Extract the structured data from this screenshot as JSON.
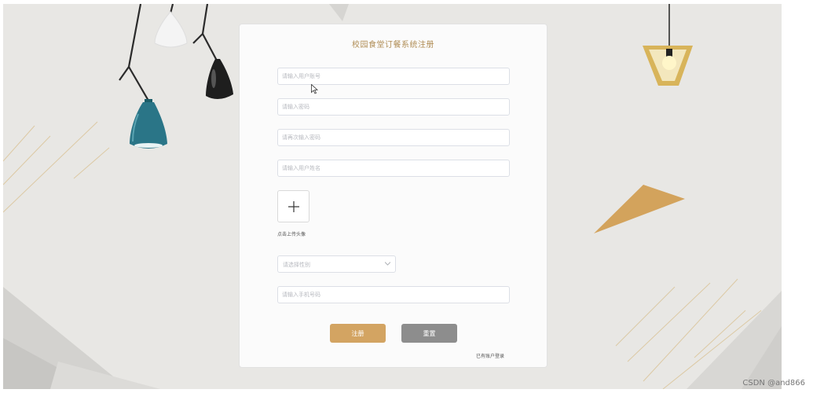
{
  "form": {
    "title": "校园食堂订餐系统注册",
    "account_placeholder": "请输入用户账号",
    "password_placeholder": "请输入密码",
    "confirm_password_placeholder": "请再次输入密码",
    "name_placeholder": "请输入用户姓名",
    "upload_label": "点击上传头像",
    "gender_placeholder": "请选择性别",
    "phone_placeholder": "请输入手机号码",
    "register_label": "注册",
    "reset_label": "重置",
    "login_link": "已有账户登录"
  },
  "icons": {
    "upload": "plus-icon",
    "select": "chevron-down-icon",
    "cursor": "mouse-pointer-icon"
  },
  "colors": {
    "accent": "#d3a462",
    "title": "#b08d55",
    "reset": "#8d8d8d",
    "background": "#e8e7e4"
  },
  "watermark": "CSDN @and866"
}
